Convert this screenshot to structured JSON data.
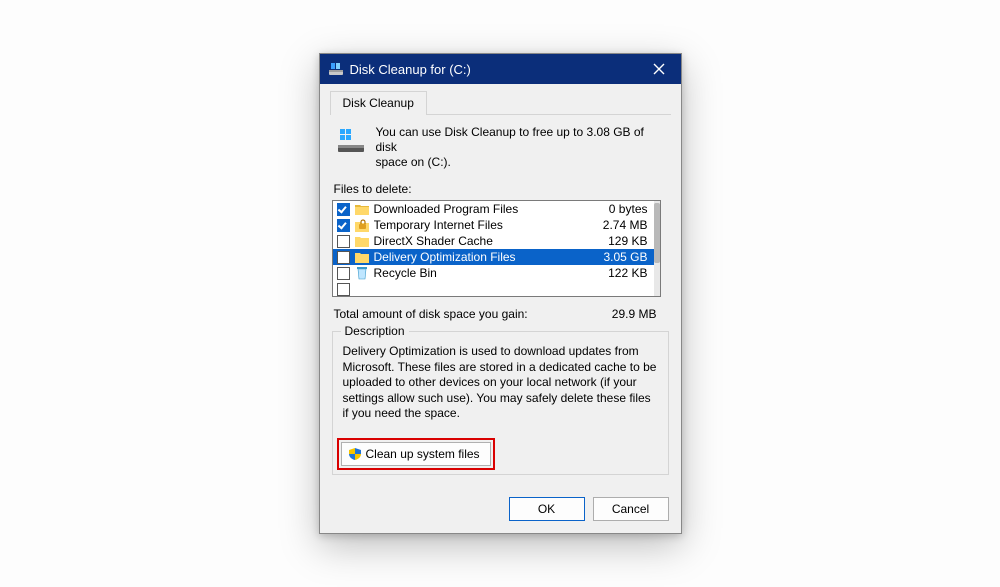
{
  "title": "Disk Cleanup for  (C:)",
  "tab": "Disk Cleanup",
  "blurb_line1": "You can use Disk Cleanup to free up to 3.08 GB of disk",
  "blurb_line2": "space on  (C:).",
  "files_label": "Files to delete:",
  "rows": [
    {
      "name": "Downloaded Program Files",
      "size": "0 bytes"
    },
    {
      "name": "Temporary Internet Files",
      "size": "2.74 MB"
    },
    {
      "name": "DirectX Shader Cache",
      "size": "129 KB"
    },
    {
      "name": "Delivery Optimization Files",
      "size": "3.05 GB"
    },
    {
      "name": "Recycle Bin",
      "size": "122 KB"
    }
  ],
  "total_label": "Total amount of disk space you gain:",
  "total_value": "29.9 MB",
  "group_title": "Description",
  "description": "Delivery Optimization is used to download updates from Microsoft. These files are stored in a dedicated cache to be uploaded to other devices on your local network (if your settings allow such use). You may safely delete these files if you need the space.",
  "sys_button": "Clean up system files",
  "ok": "OK",
  "cancel": "Cancel"
}
